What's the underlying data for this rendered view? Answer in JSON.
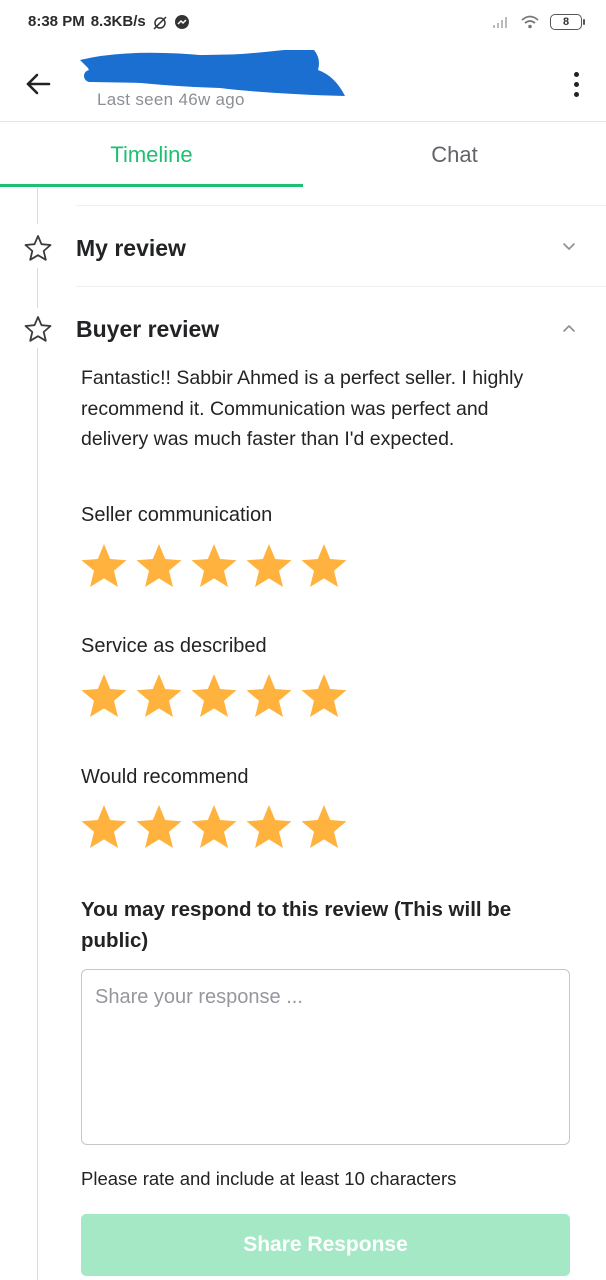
{
  "status_bar": {
    "time": "8:38 PM",
    "speed": "8.3KB/s",
    "battery": "8"
  },
  "header": {
    "last_seen": "Last seen 46w ago"
  },
  "tabs": [
    {
      "label": "Timeline",
      "active": true
    },
    {
      "label": "Chat",
      "active": false
    }
  ],
  "sections": {
    "my_review": {
      "title": "My review",
      "expanded": false
    },
    "buyer_review": {
      "title": "Buyer review",
      "expanded": true
    }
  },
  "buyer_review": {
    "text": "Fantastic!! Sabbir Ahmed is a perfect seller. I highly recommend it. Communication was perfect and delivery was much faster than I'd expected.",
    "ratings": [
      {
        "label": "Seller communication",
        "stars": 5,
        "max": 5
      },
      {
        "label": "Service as described",
        "stars": 5,
        "max": 5
      },
      {
        "label": "Would recommend",
        "stars": 5,
        "max": 5
      }
    ]
  },
  "response": {
    "title": "You may respond to this review (This will be public)",
    "placeholder": "Share your response ...",
    "value": "",
    "hint": "Please rate and include at least 10 characters",
    "button_label": "Share Response"
  },
  "colors": {
    "accent": "#1dbf73",
    "star": "#ffb33e",
    "button_disabled": "#a4e8c6",
    "redaction": "#1a6fd1"
  }
}
